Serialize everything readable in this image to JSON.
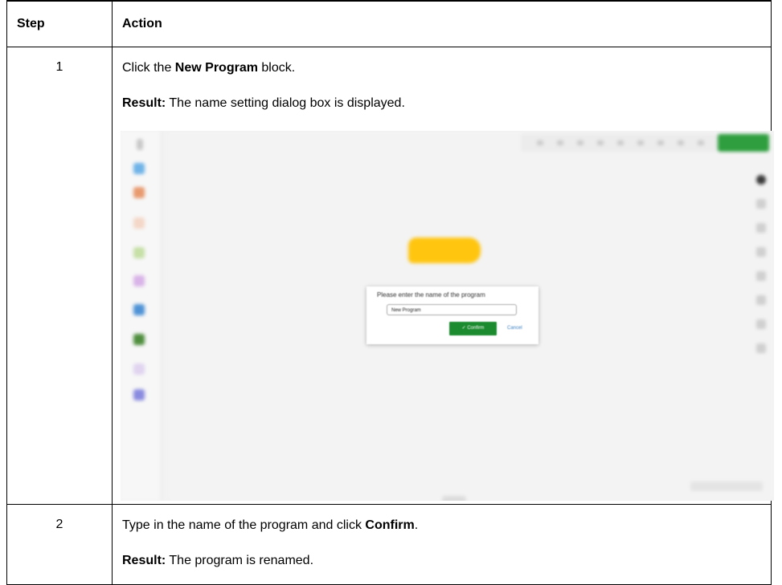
{
  "table": {
    "headers": {
      "step": "Step",
      "action": "Action"
    },
    "rows": [
      {
        "step": "1",
        "instruction": {
          "pre": "Click the ",
          "bold": "New Program",
          "post": " block."
        },
        "result": {
          "label": "Result:",
          "text": " The name setting dialog box is displayed."
        },
        "screenshot": {
          "dialog_title": "Please enter the name of the program",
          "input_value": "New Program",
          "confirm_label": "✓ Confirm",
          "cancel_label": "Cancel",
          "colors": {
            "confirm": "#1c8a2e",
            "block": "#ffc50f",
            "cancel": "#3a7fc2"
          }
        }
      },
      {
        "step": "2",
        "instruction": {
          "pre": "Type in the name of the program and click ",
          "bold": "Confirm",
          "post": "."
        },
        "result": {
          "label": "Result:",
          "text": " The program is renamed."
        }
      }
    ]
  }
}
